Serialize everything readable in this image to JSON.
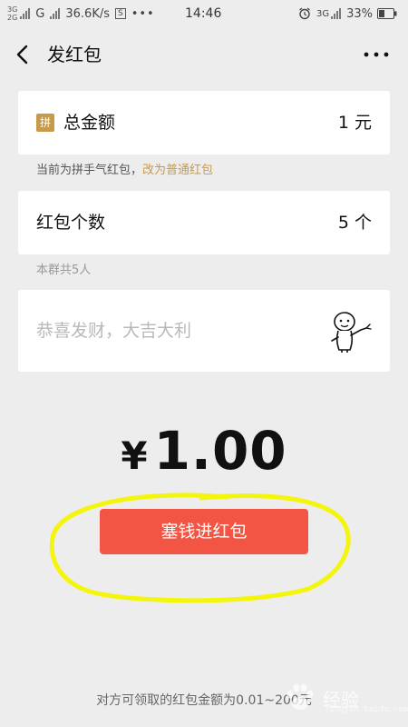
{
  "status_bar": {
    "net_top": "3G",
    "net_bottom": "2G",
    "net_type": "G",
    "speed": "36.6K/s",
    "sim_badge": "S",
    "dots": "•••",
    "time": "14:46",
    "net_right": "3G",
    "battery": "33%",
    "icons": [
      "signal-icon",
      "alarm-icon",
      "battery-icon"
    ]
  },
  "nav": {
    "title": "发红包",
    "back_icon": "chevron-left-icon",
    "more_icon": "more-dots-icon"
  },
  "total_amount": {
    "badge": "拼",
    "label": "总金额",
    "value": "1 元"
  },
  "hint_line": {
    "text": "当前为拼手气红包，",
    "link": "改为普通红包"
  },
  "packet_count": {
    "label": "红包个数",
    "value": "5 个"
  },
  "group_hint": "本群共5人",
  "blessing": {
    "placeholder": "恭喜发财，大吉大利",
    "emoji_icon": "emoji-sticker-icon"
  },
  "amount_display": {
    "currency": "¥",
    "value": "1.00"
  },
  "submit_label": "塞钱进红包",
  "footer_note": "对方可领取的红包金额为0.01~200元",
  "watermark": {
    "text": "经验",
    "sub": "jingyan.baidu.com"
  },
  "colors": {
    "background": "#ededed",
    "card": "#ffffff",
    "accent_gold": "#c79a4a",
    "button_red": "#f25543",
    "annotation_yellow": "#f4f50c"
  }
}
